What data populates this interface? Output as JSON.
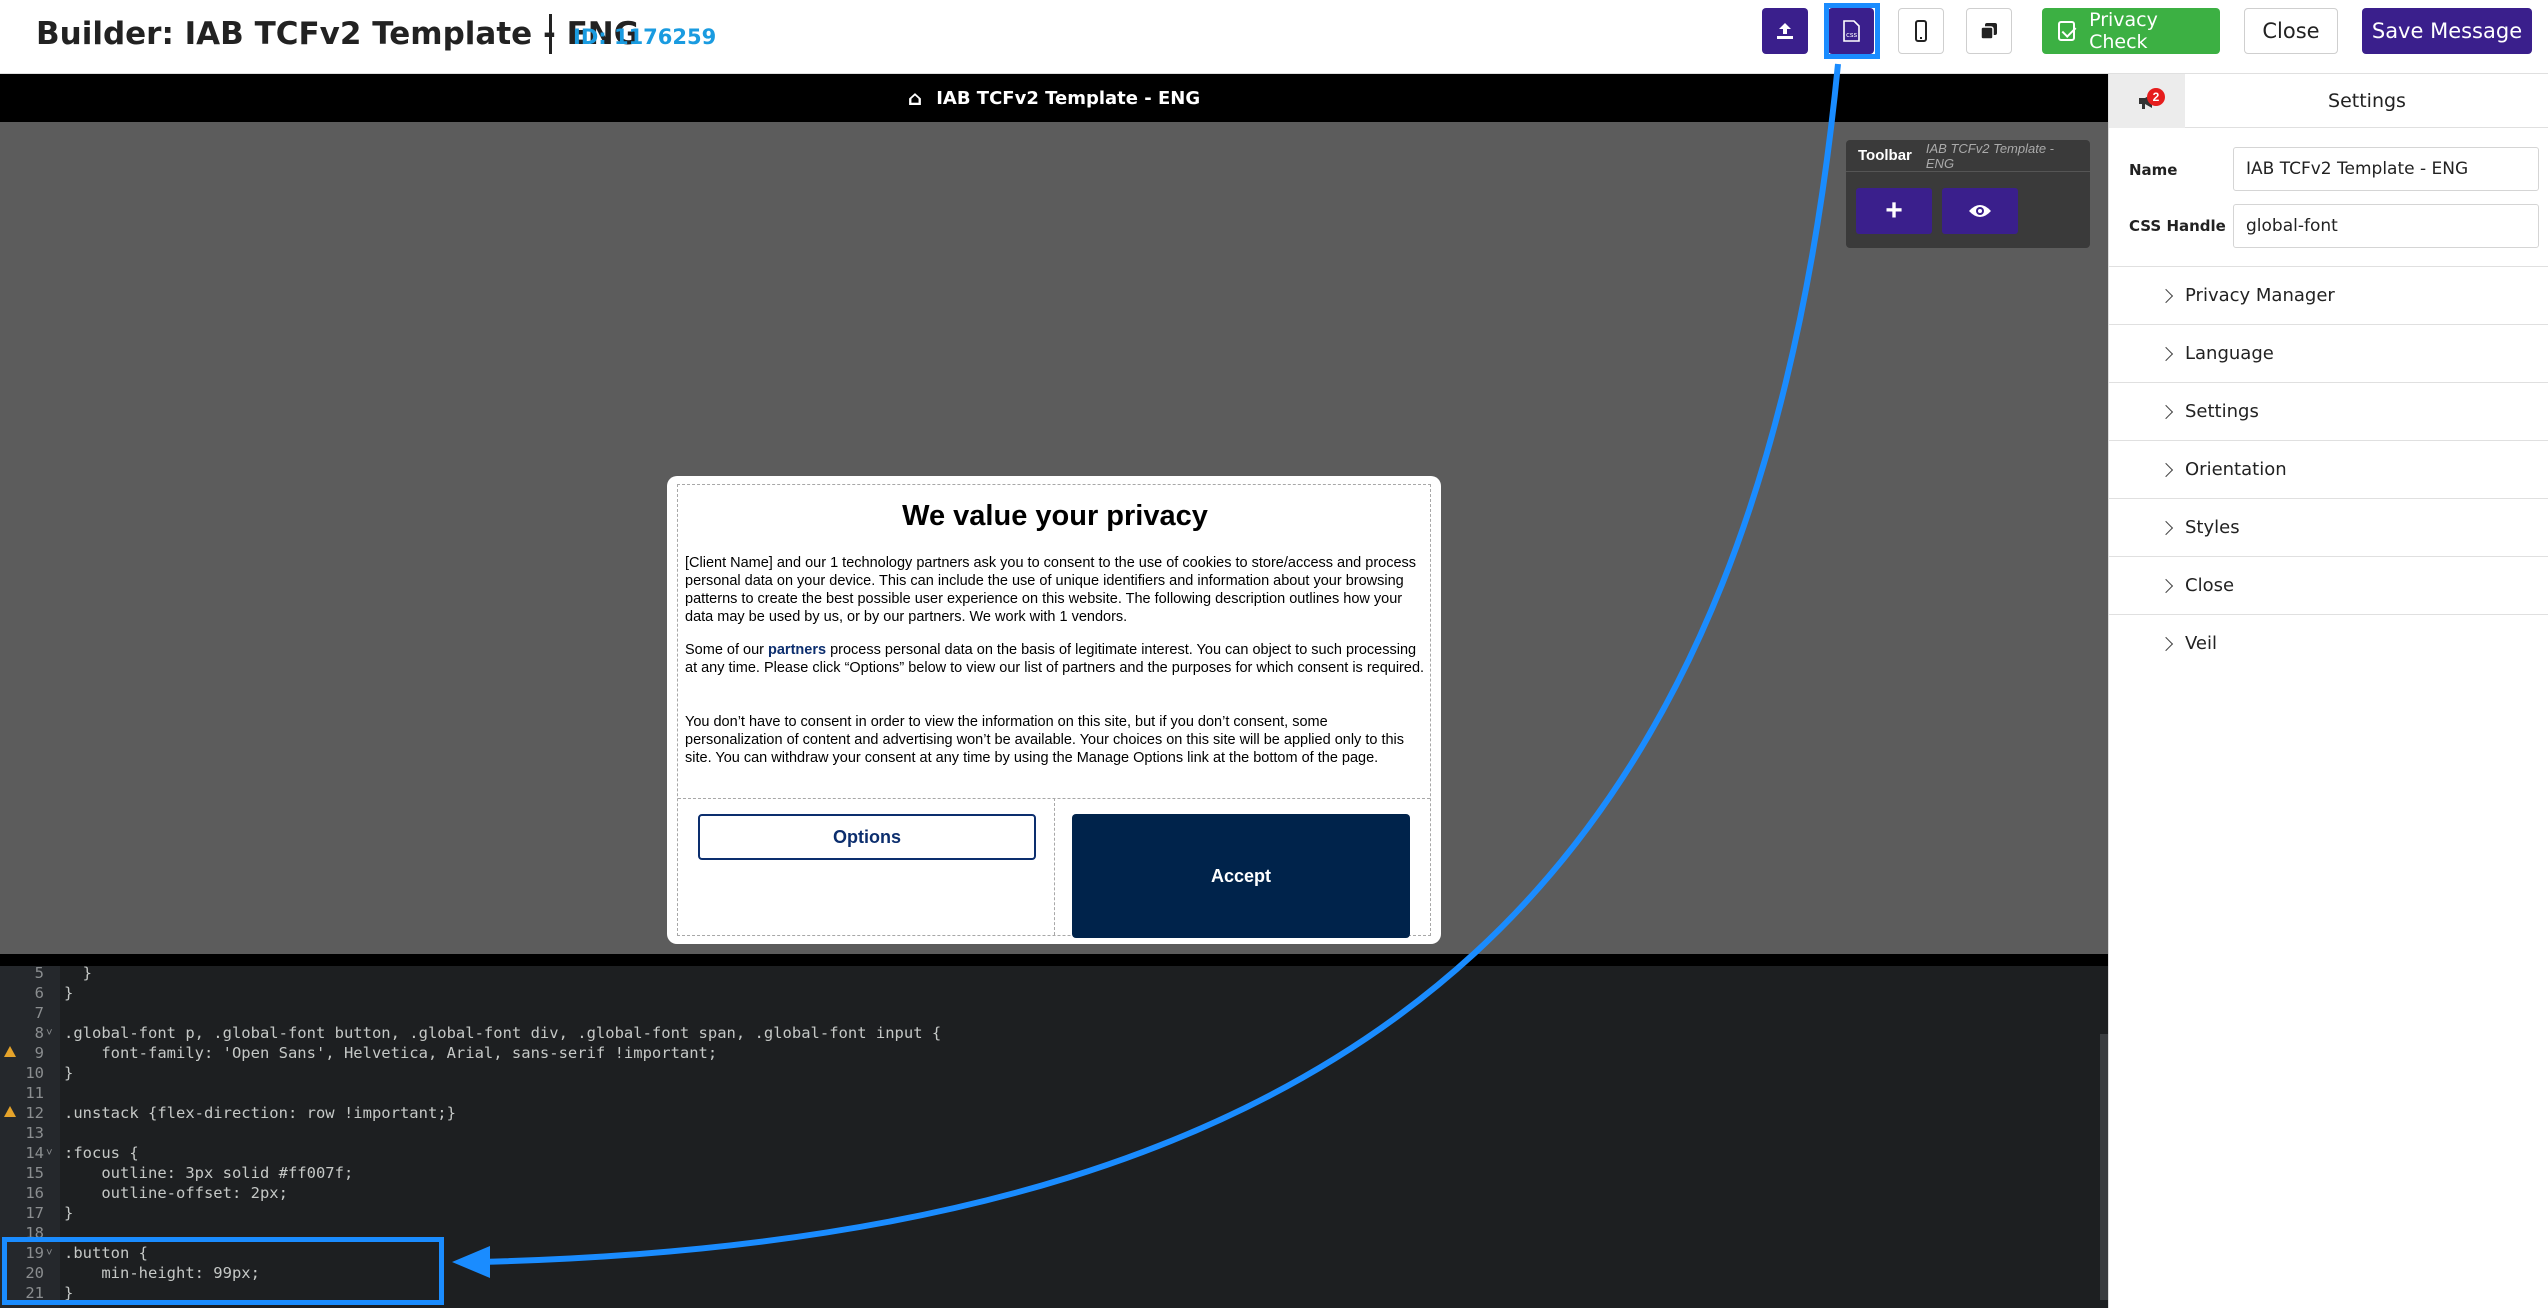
{
  "header": {
    "title": "Builder: IAB TCFv2 Template - ENG",
    "id_label": "ID: 1176259",
    "privacy_check_label": "Privacy Check",
    "close_label": "Close",
    "save_label": "Save Message"
  },
  "canvas": {
    "topbar_title": "IAB TCFv2 Template - ENG",
    "toolbar": {
      "title": "Toolbar",
      "subtitle": "IAB TCFv2 Template - ENG",
      "add_label": "+"
    }
  },
  "modal": {
    "title": "We value your privacy",
    "para1": "[Client Name] and our 1 technology partners ask you to consent to the use of cookies to store/access and process personal data on your device. This can include the use of unique identifiers and information about your browsing patterns to create the best possible user experience on this website. The following description outlines how your data may be used by us, or by our partners. We work with 1 vendors.",
    "para2_before": "Some of our ",
    "para2_link": "partners",
    "para2_after": " process personal data on the basis of legitimate interest. You can object to such processing at any time. Please click “Options” below to view our list of partners and the purposes for which consent is required.",
    "para3": "You don’t have to consent in order to view the information on this site, but if you don’t consent, some personalization of content and advertising won’t be available. Your choices on this site will be applied only to this site. You can withdraw your consent at any time by using the Manage Options link at the bottom of the page.",
    "options_label": "Options",
    "accept_label": "Accept"
  },
  "editor": {
    "lines": [
      {
        "n": "5",
        "text": "  }"
      },
      {
        "n": "6",
        "text": "}"
      },
      {
        "n": "7",
        "text": ""
      },
      {
        "n": "8",
        "text": ".global-font p, .global-font button, .global-font div, .global-font span, .global-font input {"
      },
      {
        "n": "9",
        "text": "    font-family: 'Open Sans', Helvetica, Arial, sans-serif !important;"
      },
      {
        "n": "10",
        "text": "}"
      },
      {
        "n": "11",
        "text": ""
      },
      {
        "n": "12",
        "text": ".unstack {flex-direction: row !important;}"
      },
      {
        "n": "13",
        "text": ""
      },
      {
        "n": "14",
        "text": ":focus {"
      },
      {
        "n": "15",
        "text": "    outline: 3px solid #ff007f;"
      },
      {
        "n": "16",
        "text": "    outline-offset: 2px;"
      },
      {
        "n": "17",
        "text": "}"
      },
      {
        "n": "18",
        "text": ""
      },
      {
        "n": "19",
        "text": ".button {"
      },
      {
        "n": "20",
        "text": "    min-height: 99px;"
      },
      {
        "n": "21",
        "text": "}"
      }
    ]
  },
  "panel": {
    "badge_count": "2",
    "title": "Settings",
    "name_label": "Name",
    "name_value": "IAB TCFv2 Template - ENG",
    "css_label": "CSS Handle",
    "css_value": "global-font",
    "sections": [
      "Privacy Manager",
      "Language",
      "Settings",
      "Orientation",
      "Styles",
      "Close",
      "Veil"
    ]
  },
  "colors": {
    "brand_purple": "#3a1f8c",
    "privacy_green": "#3cb043",
    "id_blue": "#1a9be0",
    "annotation_blue": "#1a8cff",
    "accept_navy": "#00234b"
  }
}
